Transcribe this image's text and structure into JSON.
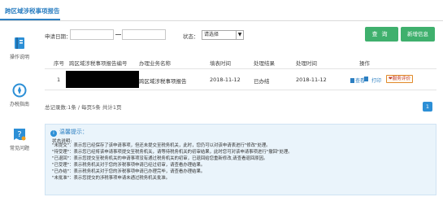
{
  "header": {
    "page_tab": "跨区域涉税事项报告"
  },
  "sidebar": {
    "items": [
      {
        "label": "操作说明",
        "icon": "book-icon"
      },
      {
        "label": "办税指南",
        "icon": "compass-icon"
      },
      {
        "label": "常见问题",
        "icon": "question-icon"
      }
    ]
  },
  "search": {
    "date_label": "申请日期：",
    "date_from": "",
    "date_to": "",
    "status_label": "状态：",
    "status_value": "请选择",
    "query_button": "查询",
    "new_button": "新增信息"
  },
  "table": {
    "headers": [
      "序号",
      "跨区域涉税事项报告编号",
      "办理业务名称",
      "填表时间",
      "处理结果",
      "处理时间",
      "操作"
    ],
    "rows": [
      {
        "index": "1",
        "number": "",
        "business": "跨区域涉税事项报告",
        "fill_time": "2018-11-12",
        "result": "已办结",
        "handle_time": "2018-11-12",
        "ops": [
          "查看",
          "打印"
        ],
        "evaluate": "服务评价"
      }
    ]
  },
  "pager": {
    "summary": "总记录数:1条 / 每页5条 共计1页",
    "current_page": "1"
  },
  "tips": {
    "title": "温馨提示：",
    "subtitle": "状态说明:",
    "lines": [
      "\"未提交\"：表示您已经保存了该申请事项，但还未提交至税务机关，此时，您仍可以对该申请表进行\"修改\"处理。",
      "\"待受理\"：表示您已经将该申请事项提交至税务机关，请等待税务机关的初审结果，此时您可对该申请事项进行\"撤回\"处理。",
      "\"已退回\"：表示您提交至税务机关的申请事项没有通过税务机关的初审，已退回给您重新修改,请查看退回原因。",
      "\"已受理\"：表示税务机关对于您的涉税事项申请已经过初审，请查看办理结果。",
      "\"已办结\"：表示税务机关对于您的涉税事项申请已办理完毕，请查看办理结果。",
      "\"未批准\"：表示您提交的涉税事项申请未通过税务机关批准。"
    ]
  },
  "colors": {
    "accent": "#2c7fc2",
    "button_green": "#3fb06d",
    "tips_bg": "#eaf4fb"
  }
}
